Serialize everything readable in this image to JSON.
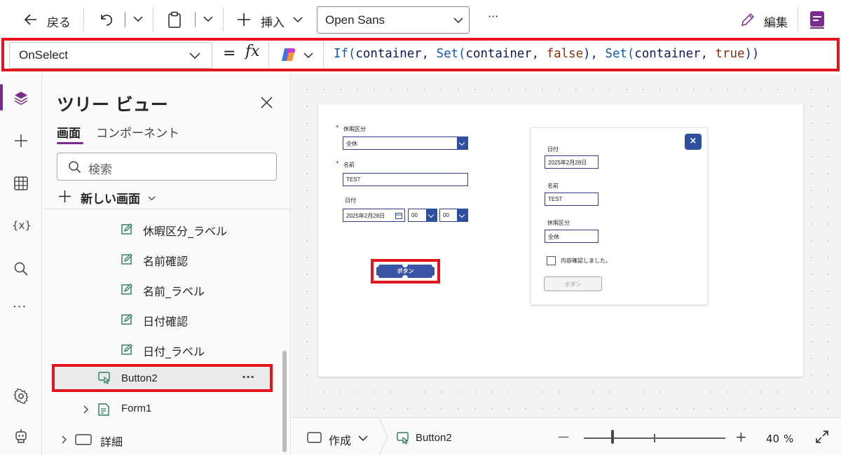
{
  "toolbar": {
    "back_label": "戻る",
    "insert_label": "挿入",
    "font_name": "Open Sans",
    "more_label": "···",
    "edit_label": "編集"
  },
  "formula_bar": {
    "property": "OnSelect",
    "equals": "=",
    "fx": "fx",
    "formula_parts": [
      "If(",
      "container",
      ", ",
      "Set(",
      "container",
      ", ",
      "false",
      "), ",
      "Set(",
      "container",
      ", ",
      "true",
      "))"
    ]
  },
  "tree": {
    "title": "ツリー ビュー",
    "tabs": [
      "画面",
      "コンポーネント"
    ],
    "search_placeholder": "検索",
    "new_screen_label": "新しい画面",
    "items": [
      {
        "label": "休暇区分_ラベル",
        "icon": "edit-label-icon"
      },
      {
        "label": "名前確認",
        "icon": "edit-label-icon"
      },
      {
        "label": "名前_ラベル",
        "icon": "edit-label-icon"
      },
      {
        "label": "日付確認",
        "icon": "edit-label-icon"
      },
      {
        "label": "日付_ラベル",
        "icon": "edit-label-icon"
      },
      {
        "label": "Button2",
        "icon": "button-icon",
        "selected": true
      },
      {
        "label": "Form1",
        "icon": "form-icon"
      },
      {
        "label": "詳細",
        "icon": "container-icon"
      }
    ],
    "row_more": "···"
  },
  "canvas_form": {
    "leave_type_label": "休暇区分",
    "leave_type_value": "全休",
    "name_label": "名前",
    "name_value": "TEST",
    "date_label": "日付",
    "date_value": "2025年2月28日",
    "hour_value": "00",
    "minute_value": "00",
    "time_sep": ":",
    "required_mark": "*",
    "button_label": "ボタン"
  },
  "popup": {
    "close_glyph": "×",
    "date_label": "日付",
    "date_value": "2025年2月28日",
    "name_label": "名前",
    "name_value": "TEST",
    "leave_type_label": "休暇区分",
    "leave_type_value": "全休",
    "confirm_text": "内容確認しました。",
    "button_label": "ボタン"
  },
  "status": {
    "mode_label": "作成",
    "selected_control": "Button2",
    "zoom_value": "40",
    "zoom_unit": "%",
    "zoom_minus": "—",
    "zoom_plus": "+"
  },
  "colors": {
    "accent": "#7a2b8f",
    "highlight": "#e3141e",
    "control_blue": "#2e4fa0"
  }
}
